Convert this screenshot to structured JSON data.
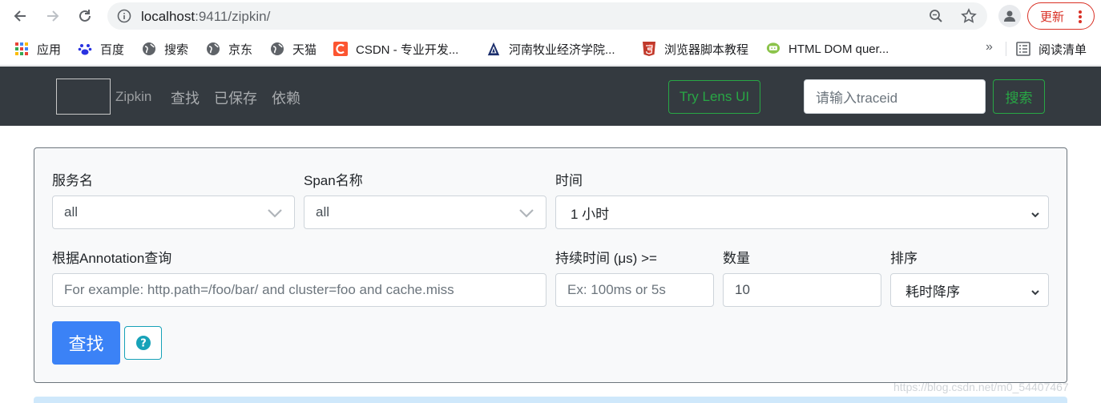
{
  "browser": {
    "url_host": "localhost",
    "url_path": ":9411/zipkin/",
    "update_label": "更新"
  },
  "bookmarks": {
    "items": [
      {
        "label": "应用",
        "icon": "apps-grid-icon"
      },
      {
        "label": "百度",
        "icon": "baidu-paw-icon"
      },
      {
        "label": "搜索",
        "icon": "globe-icon"
      },
      {
        "label": "京东",
        "icon": "globe-icon"
      },
      {
        "label": "天猫",
        "icon": "globe-icon"
      },
      {
        "label": "CSDN - 专业开发...",
        "icon": "csdn-icon"
      },
      {
        "label": "河南牧业经济学院...",
        "icon": "school-icon"
      },
      {
        "label": "浏览器脚本教程",
        "icon": "html5-shield-icon"
      },
      {
        "label": "HTML DOM quer...",
        "icon": "chat-icon"
      }
    ],
    "more": "»",
    "reading_list": "阅读清单"
  },
  "navbar": {
    "brand": "Zipkin",
    "links": [
      "查找",
      "已保存",
      "依赖"
    ],
    "lens_button": "Try Lens UI",
    "trace_placeholder": "请输入traceid",
    "search_button": "搜索"
  },
  "form": {
    "service_label": "服务名",
    "service_value": "all",
    "span_label": "Span名称",
    "span_value": "all",
    "time_label": "时间",
    "time_value": "1 小时",
    "annotation_label": "根据Annotation查询",
    "annotation_placeholder": "For example: http.path=/foo/bar/ and cluster=foo and cache.miss",
    "duration_label": "持续时间 (μs) >=",
    "duration_placeholder": "Ex: 100ms or 5s",
    "limit_label": "数量",
    "limit_value": "10",
    "sort_label": "排序",
    "sort_value": "耗时降序",
    "find_button": "查找",
    "help_button": "?"
  },
  "watermark": "https://blog.csdn.net/m0_54407467"
}
